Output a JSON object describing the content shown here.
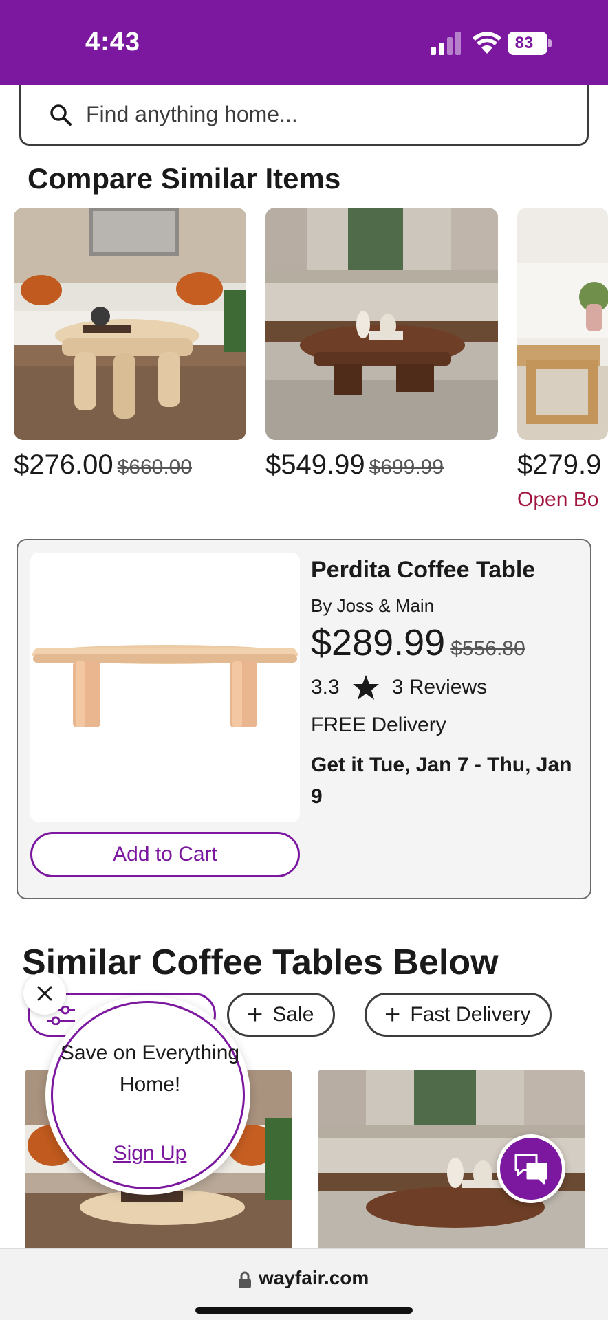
{
  "status_bar": {
    "time": "4:43",
    "battery": "83",
    "background": "#7b189f"
  },
  "search": {
    "placeholder": "Find anything home...",
    "icon": "search-icon"
  },
  "compare": {
    "title": "Compare Similar Items",
    "items": [
      {
        "price": "$276.00",
        "was": "$660.00",
        "badge": ""
      },
      {
        "price": "$549.99",
        "was": "$699.99",
        "badge": ""
      },
      {
        "price": "$279.9",
        "was": "",
        "badge": "Open Bo"
      }
    ]
  },
  "featured": {
    "title": "Perdita Coffee Table",
    "brand": "By Joss & Main",
    "price": "$289.99",
    "was": "$556.80",
    "rating": "3.3",
    "reviews": "3 Reviews",
    "delivery": "FREE Delivery",
    "delivery_date": "Get it Tue, Jan 7 - Thu, Jan 9",
    "add_to_cart": "Add to Cart"
  },
  "similar": {
    "title": "Similar Coffee Tables Below",
    "chips": [
      "Sale",
      "Fast Delivery"
    ]
  },
  "promo": {
    "text": "Save on Everything Home!",
    "link": "Sign Up"
  },
  "browser": {
    "url": "wayfair.com"
  },
  "colors": {
    "accent": "#7b189f",
    "open_box": "#a0153e"
  }
}
